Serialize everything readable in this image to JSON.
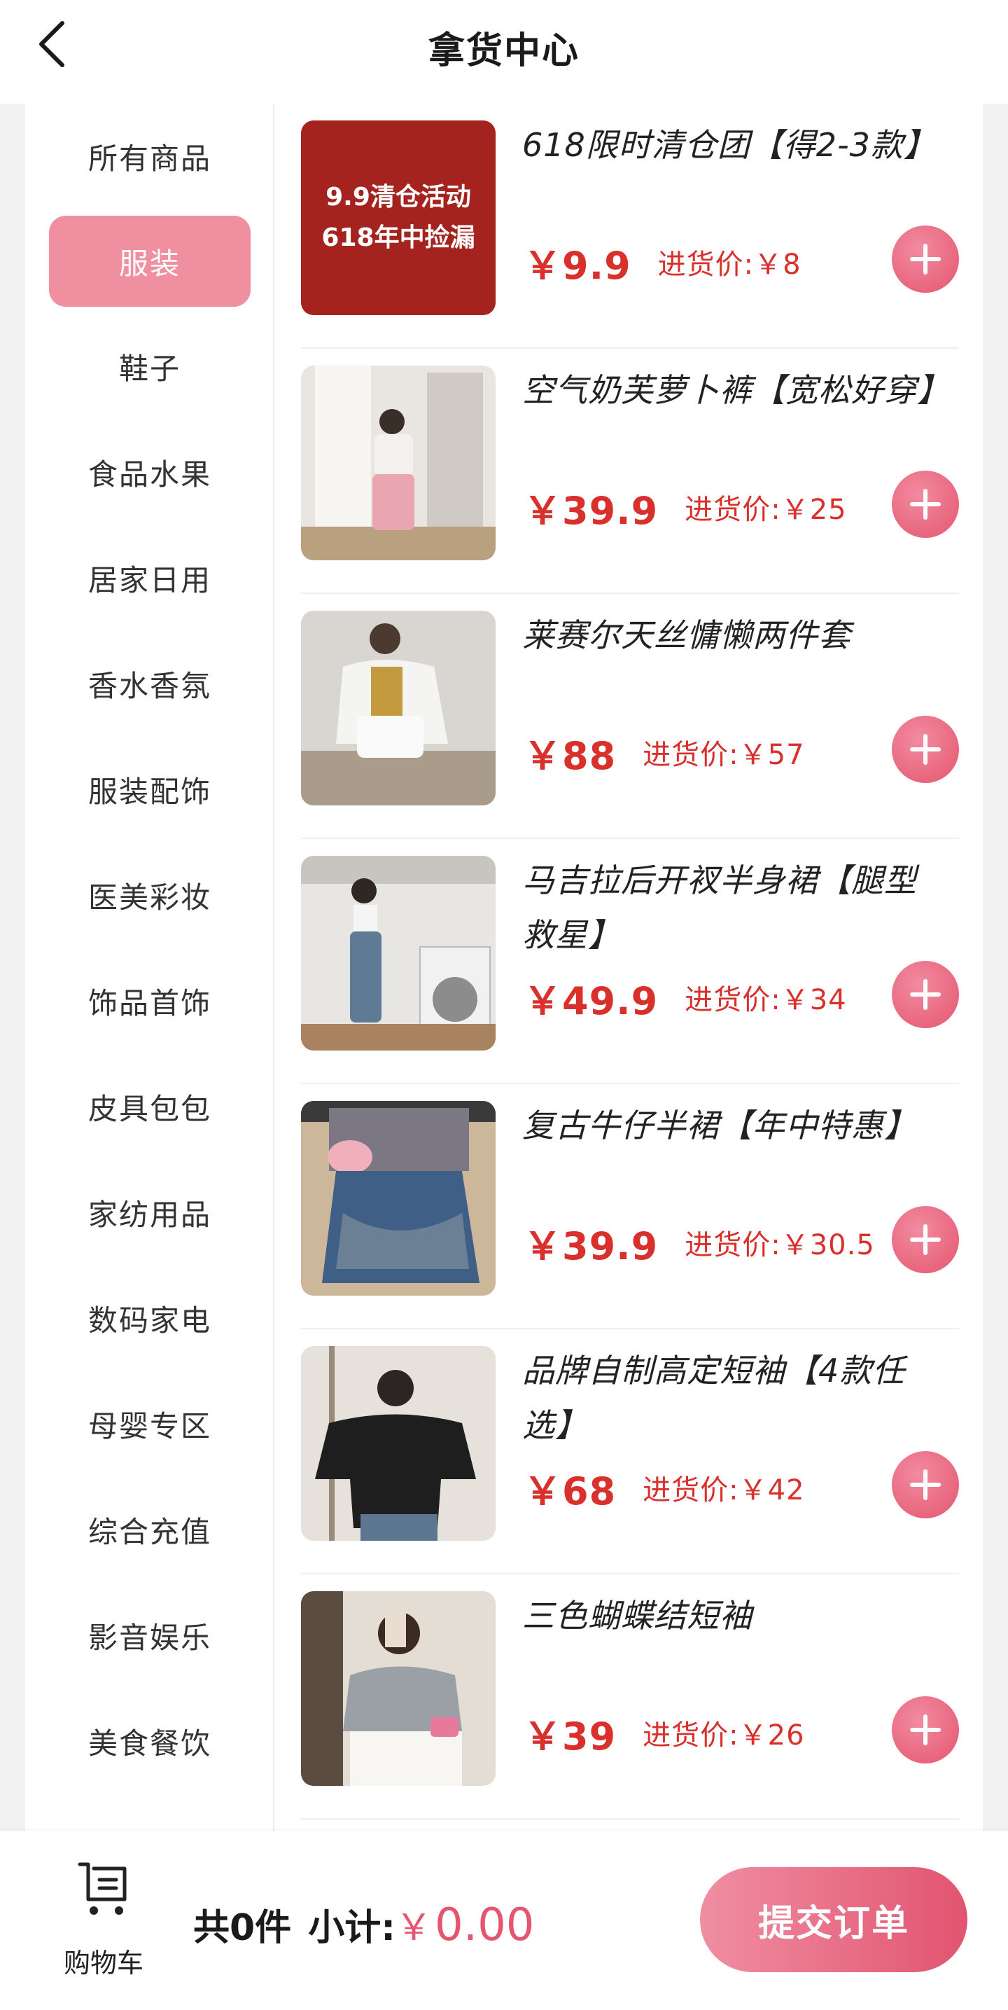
{
  "header": {
    "title": "拿货中心",
    "back_icon": "chevron-left-icon"
  },
  "sidebar": {
    "items": [
      {
        "label": "所有商品",
        "active": false
      },
      {
        "label": "服装",
        "active": true
      },
      {
        "label": "鞋子",
        "active": false
      },
      {
        "label": "食品水果",
        "active": false
      },
      {
        "label": "居家日用",
        "active": false
      },
      {
        "label": "香水香氛",
        "active": false
      },
      {
        "label": "服装配饰",
        "active": false
      },
      {
        "label": "医美彩妆",
        "active": false
      },
      {
        "label": "饰品首饰",
        "active": false
      },
      {
        "label": "皮具包包",
        "active": false
      },
      {
        "label": "家纺用品",
        "active": false
      },
      {
        "label": "数码家电",
        "active": false
      },
      {
        "label": "母婴专区",
        "active": false
      },
      {
        "label": "综合充值",
        "active": false
      },
      {
        "label": "影音娱乐",
        "active": false
      },
      {
        "label": "美食餐饮",
        "active": false
      }
    ]
  },
  "products": [
    {
      "title": "618限时清仓团【得2-3款】",
      "price": "￥9.9",
      "cost": "进货价:￥8",
      "thumb_line1": "9.9清仓活动",
      "thumb_line2": "618年中捡漏"
    },
    {
      "title": "空气奶芙萝卜裤【宽松好穿】",
      "price": "￥39.9",
      "cost": "进货价:￥25"
    },
    {
      "title": "莱赛尔天丝慵懒两件套",
      "price": "￥88",
      "cost": "进货价:￥57"
    },
    {
      "title": "马吉拉后开衩半身裙【腿型救星】",
      "price": "￥49.9",
      "cost": "进货价:￥34"
    },
    {
      "title": "复古牛仔半裙【年中特惠】",
      "price": "￥39.9",
      "cost": "进货价:￥30.5"
    },
    {
      "title": "品牌自制高定短袖【4款任选】",
      "price": "￥68",
      "cost": "进货价:￥42"
    },
    {
      "title": "三色蝴蝶结短袖",
      "price": "￥39",
      "cost": "进货价:￥26"
    }
  ],
  "footer": {
    "cart_label": "购物车",
    "count_text": "共0件",
    "subtotal_label": "小计:",
    "currency": "￥",
    "subtotal_value": "0.00",
    "submit_label": "提交订单"
  },
  "colors": {
    "accent": "#e4566f",
    "price": "#d9302c",
    "active_tab": "#ef8fa0"
  }
}
